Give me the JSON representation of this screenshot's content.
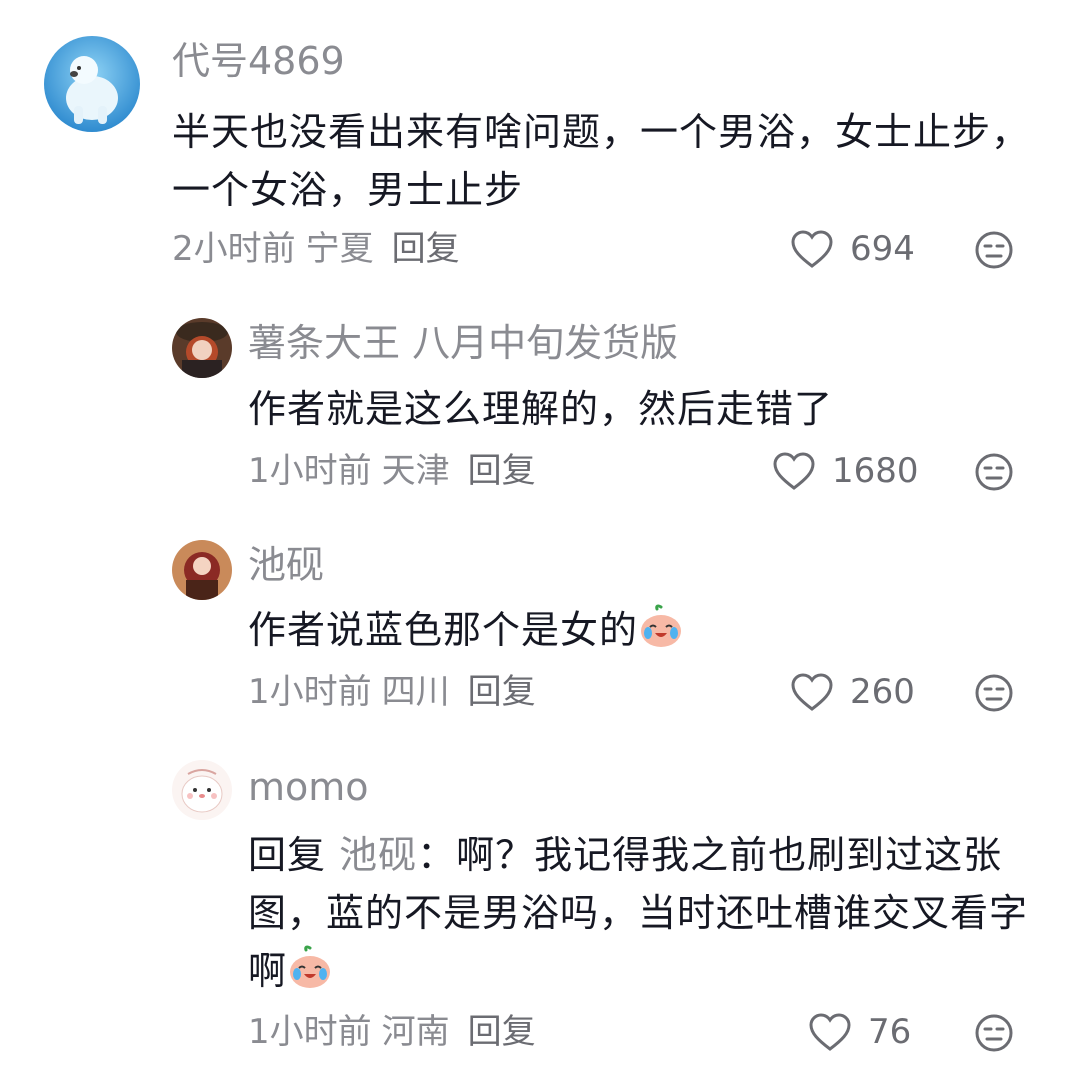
{
  "comments": [
    {
      "username": "代号4869",
      "content": "半天也没看出来有啥问题，一个男浴，女士止步，一个女浴，男士止步",
      "time": "2小时前",
      "location": "宁夏",
      "reply_label": "回复",
      "likes": "694",
      "avatar_icon": "polar-bear-avatar"
    },
    {
      "username": "薯条大王 八月中旬发货版",
      "content": "作者就是这么理解的，然后走错了",
      "time": "1小时前",
      "location": "天津",
      "reply_label": "回复",
      "likes": "1680",
      "avatar_icon": "anime-avatar"
    },
    {
      "username": "池砚",
      "content": "作者说蓝色那个是女的",
      "emoji": "crying-laughing-emoji",
      "time": "1小时前",
      "location": "四川",
      "reply_label": "回复",
      "likes": "260",
      "avatar_icon": "anime-avatar"
    },
    {
      "username": "momo",
      "reply_prefix": "回复",
      "reply_target": "池砚",
      "content": "：啊？我记得我之前也刷到过这张图，蓝的不是男浴吗，当时还吐槽谁交叉看字啊",
      "emoji": "crying-laughing-emoji",
      "time": "1小时前",
      "location": "河南",
      "reply_label": "回复",
      "likes": "76",
      "avatar_icon": "cartoon-seal-avatar"
    }
  ],
  "colors": {
    "text": "#161823",
    "secondary": "#8a8b91",
    "background": "#ffffff"
  }
}
